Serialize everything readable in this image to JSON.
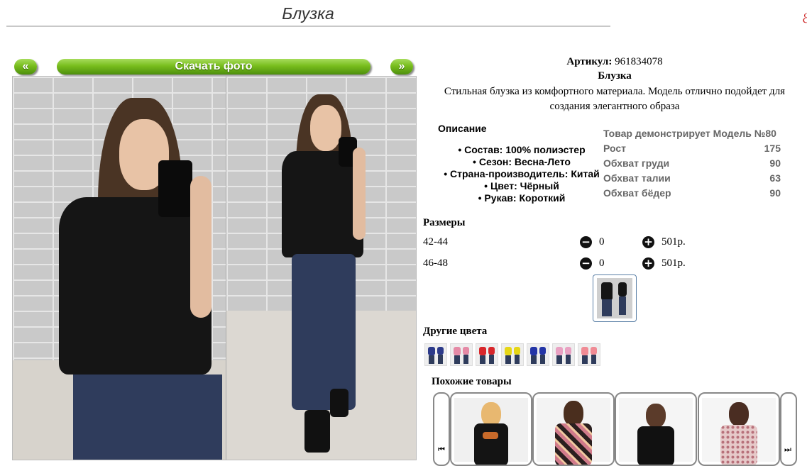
{
  "page": {
    "title": "Блузка"
  },
  "gallery": {
    "prev_label": "«",
    "next_label": "»",
    "download_label": "Скачать фото"
  },
  "product": {
    "article_label": "Артикул:",
    "article_value": "961834078",
    "name": "Блузка",
    "summary": "Стильная блузка из комфортного материала. Модель отлично подойдет для создания элегантного образа"
  },
  "description": {
    "heading": "Описание",
    "items": [
      "Состав: 100% полиэстер",
      "Сезон: Весна-Лето",
      "Страна-производитель: Китай",
      "Цвет: Чёрный",
      "Рукав: Короткий"
    ]
  },
  "model": {
    "heading": "Товар демонстрирует Модель №80",
    "rows": [
      {
        "label": "Рост",
        "value": "175"
      },
      {
        "label": "Обхват груди",
        "value": "90"
      },
      {
        "label": "Обхват талии",
        "value": "63"
      },
      {
        "label": "Обхват бёдер",
        "value": "90"
      }
    ]
  },
  "sizes": {
    "heading": "Размеры",
    "rows": [
      {
        "size": "42-44",
        "qty": "0",
        "price": "501р."
      },
      {
        "size": "46-48",
        "qty": "0",
        "price": "501р."
      }
    ]
  },
  "other_colors": {
    "heading": "Другие цвета",
    "swatches": [
      "#2c3a8a",
      "#e58aa6",
      "#d8262b",
      "#e6d617",
      "#2334a6",
      "#e9a1c2",
      "#f08b95"
    ]
  },
  "similar": {
    "heading": "Похожие товары"
  },
  "colors": {
    "accent_green": "#78bd1d",
    "rule": "#c8c8c8"
  }
}
